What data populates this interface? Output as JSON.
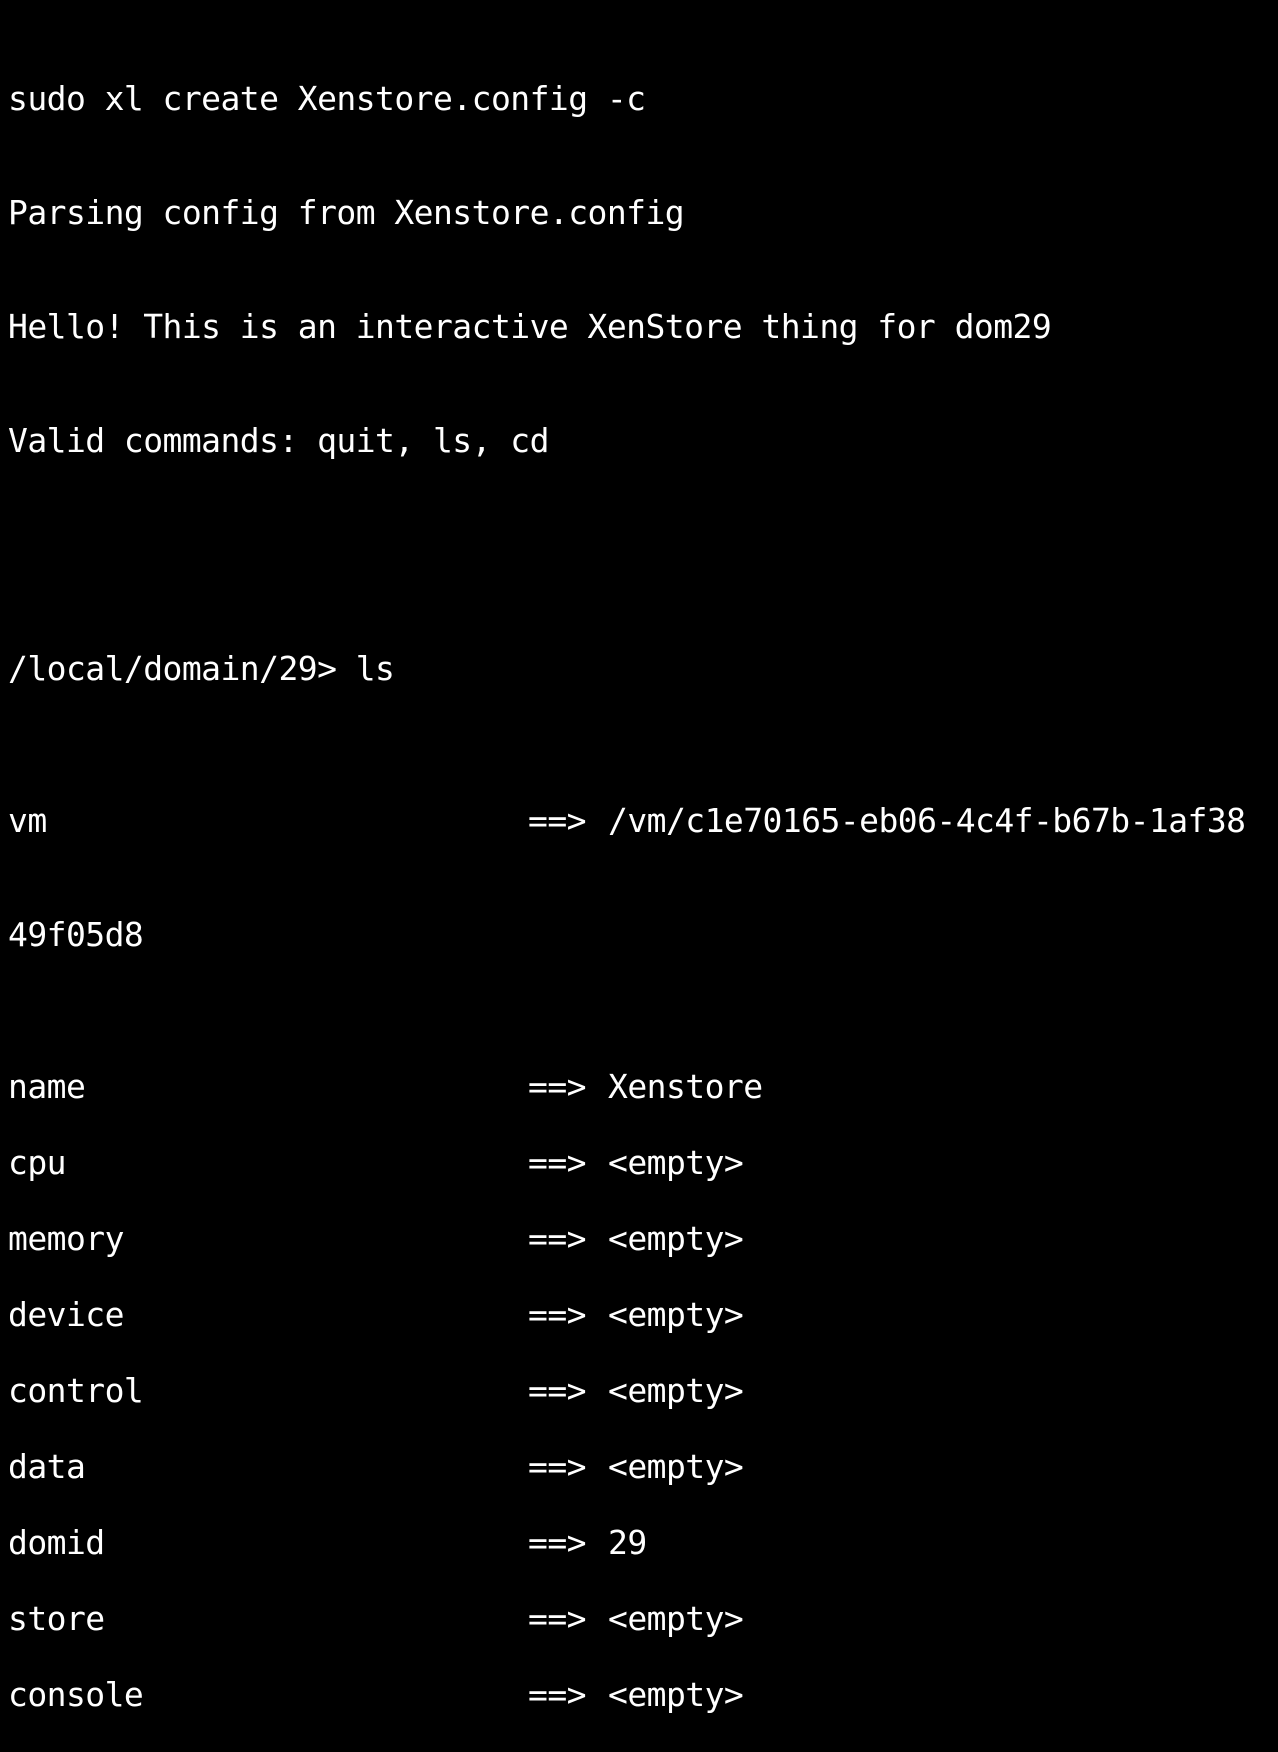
{
  "terminal": {
    "lines": [
      "sudo xl create Xenstore.config -c",
      "Parsing config from Xenstore.config",
      "Hello! This is an interactive XenStore thing for dom29",
      "Valid commands: quit, ls, cd"
    ],
    "prompt": "/local/domain/29> ls",
    "separator": "==>",
    "vm": {
      "key": "vm",
      "value": "/vm/c1e70165-eb06-4c4f-b67b-1af38",
      "value_wrap": "49f05d8"
    },
    "entries": [
      {
        "key": "name",
        "value": "Xenstore"
      },
      {
        "key": "cpu",
        "value": "<empty>"
      },
      {
        "key": "memory",
        "value": "<empty>"
      },
      {
        "key": "device",
        "value": "<empty>"
      },
      {
        "key": "control",
        "value": "<empty>"
      },
      {
        "key": "data",
        "value": "<empty>"
      },
      {
        "key": "domid",
        "value": "29"
      },
      {
        "key": "store",
        "value": "<empty>"
      },
      {
        "key": "console",
        "value": "<empty>"
      }
    ]
  }
}
